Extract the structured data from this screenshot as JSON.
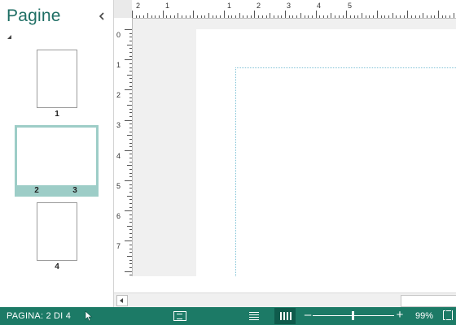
{
  "pages_pane": {
    "title": "Pagine",
    "collapse_icon": "chevron-left-icon",
    "thumbnails": [
      {
        "label": "1"
      },
      {
        "labels": [
          "2",
          "3"
        ],
        "selected": true
      },
      {
        "label": "4"
      }
    ]
  },
  "rulers": {
    "horizontal_labels": [
      "2",
      "1",
      "1",
      "2",
      "3",
      "4",
      "5"
    ],
    "vertical_labels": [
      "0",
      "1",
      "2",
      "3",
      "4",
      "5",
      "6",
      "7"
    ]
  },
  "status_bar": {
    "page_indicator": "PAGINA: 2 DI 4",
    "zoom_level": "99%",
    "zoom_fraction": 0.49
  },
  "colors": {
    "accent": "#1e6e64",
    "status_bar": "#1c7a66",
    "selection": "#9dcdc7"
  }
}
